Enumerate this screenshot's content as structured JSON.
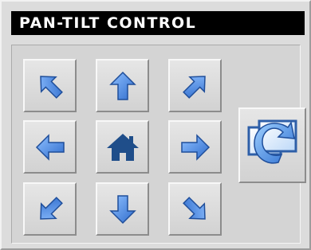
{
  "panel": {
    "title": "PAN-TILT CONTROL"
  },
  "buttons": {
    "up_left": {
      "icon": "arrow-up-left-icon"
    },
    "up": {
      "icon": "arrow-up-icon"
    },
    "up_right": {
      "icon": "arrow-up-right-icon"
    },
    "left": {
      "icon": "arrow-left-icon"
    },
    "home": {
      "icon": "home-icon"
    },
    "right": {
      "icon": "arrow-right-icon"
    },
    "down_left": {
      "icon": "arrow-down-left-icon"
    },
    "down": {
      "icon": "arrow-down-icon"
    },
    "down_right": {
      "icon": "arrow-down-right-icon"
    },
    "refresh": {
      "icon": "refresh-icon"
    }
  },
  "colors": {
    "icon_fill": "#3f7fd6",
    "icon_stroke": "#1f4e9a",
    "home_fill": "#1f4e8a"
  }
}
